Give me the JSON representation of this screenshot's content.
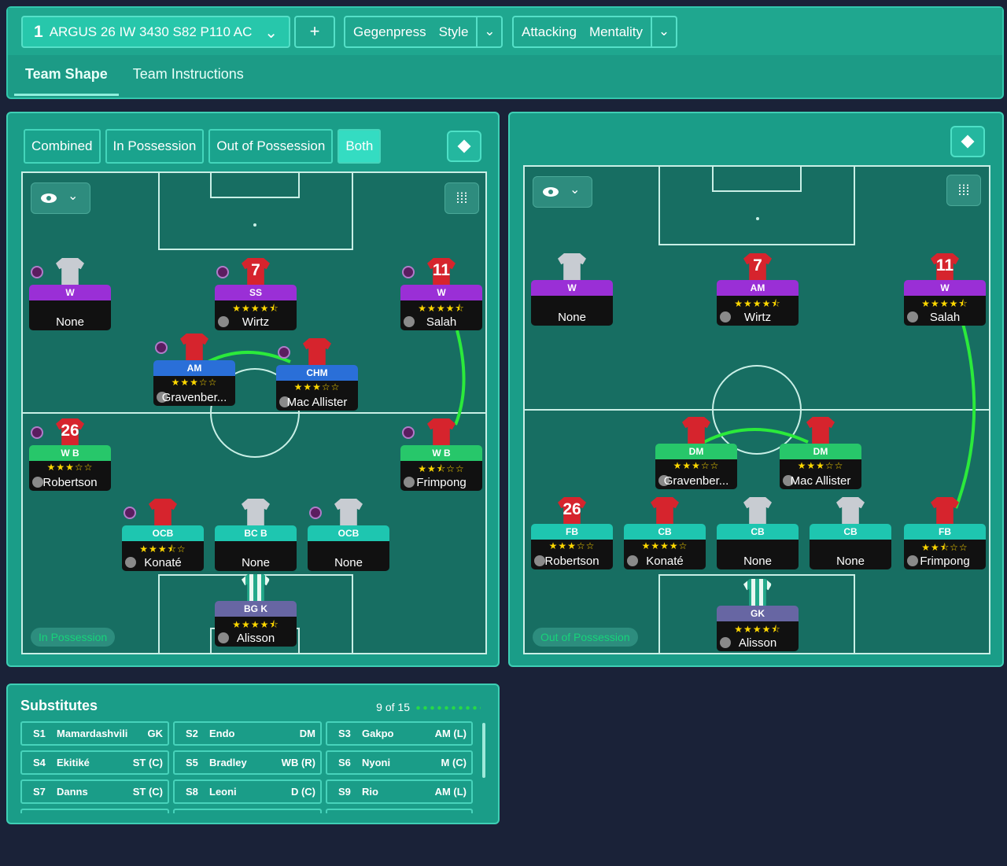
{
  "header": {
    "tactic_number": "1",
    "tactic_name": "ARGUS 26 IW 3430 S82 P110 AC",
    "add_label": "+",
    "style": {
      "label": "Gegenpress",
      "value": "Style"
    },
    "mentality": {
      "label": "Attacking",
      "value": "Mentality"
    },
    "tabs": [
      "Team Shape",
      "Team Instructions"
    ]
  },
  "left_panel": {
    "filters": [
      "Combined",
      "In Possession",
      "Out of Possession",
      "Both"
    ],
    "active_filter": "Both",
    "phase": "In Possession",
    "players": [
      {
        "id": "lw",
        "number": "",
        "shirt": "grey",
        "role": "W",
        "stars": "",
        "name": "None",
        "role_color": "purple",
        "badge": true
      },
      {
        "id": "ss",
        "number": "7",
        "shirt": "red",
        "role": "SS",
        "stars": "★★★★⯪",
        "name": "Wirtz",
        "role_color": "purple",
        "badge": true
      },
      {
        "id": "rw",
        "number": "11",
        "shirt": "red",
        "role": "W",
        "stars": "★★★★⯪",
        "name": "Salah",
        "role_color": "purple",
        "badge": true
      },
      {
        "id": "am",
        "number": "",
        "shirt": "red",
        "role": "AM",
        "stars": "★★★☆☆",
        "name": "Gravenber...",
        "role_color": "blue",
        "badge": true
      },
      {
        "id": "chm",
        "number": "",
        "shirt": "red",
        "role": "CHM",
        "stars": "★★★☆☆",
        "name": "Mac Allister",
        "role_color": "blue",
        "badge": true
      },
      {
        "id": "lwb",
        "number": "26",
        "shirt": "red",
        "role": "W B",
        "stars": "★★★☆☆",
        "name": "Robertson",
        "role_color": "green",
        "badge": true
      },
      {
        "id": "rwb",
        "number": "",
        "shirt": "red",
        "role": "W B",
        "stars": "★★⯪☆☆",
        "name": "Frimpong",
        "role_color": "green",
        "badge": true
      },
      {
        "id": "ocb1",
        "number": "",
        "shirt": "red",
        "role": "OCB",
        "stars": "★★★⯪☆",
        "name": "Konaté",
        "role_color": "teal",
        "badge": true
      },
      {
        "id": "bcb",
        "number": "",
        "shirt": "grey",
        "role": "BC B",
        "stars": "",
        "name": "None",
        "role_color": "teal",
        "badge": false
      },
      {
        "id": "ocb2",
        "number": "",
        "shirt": "grey",
        "role": "OCB",
        "stars": "",
        "name": "None",
        "role_color": "teal",
        "badge": true
      },
      {
        "id": "gk",
        "number": "",
        "shirt": "stripe",
        "role": "BG K",
        "stars": "★★★★⯪",
        "name": "Alisson",
        "role_color": "slate",
        "badge": false
      }
    ]
  },
  "right_panel": {
    "phase": "Out of Possession",
    "players": [
      {
        "id": "lw",
        "number": "",
        "shirt": "grey",
        "role": "W",
        "stars": "",
        "name": "None",
        "role_color": "purple"
      },
      {
        "id": "am",
        "number": "7",
        "shirt": "red",
        "role": "AM",
        "stars": "★★★★⯪",
        "name": "Wirtz",
        "role_color": "purple"
      },
      {
        "id": "rw",
        "number": "11",
        "shirt": "red",
        "role": "W",
        "stars": "★★★★⯪",
        "name": "Salah",
        "role_color": "purple"
      },
      {
        "id": "dm1",
        "number": "",
        "shirt": "red",
        "role": "DM",
        "stars": "★★★☆☆",
        "name": "Gravenber...",
        "role_color": "green"
      },
      {
        "id": "dm2",
        "number": "",
        "shirt": "red",
        "role": "DM",
        "stars": "★★★☆☆",
        "name": "Mac Allister",
        "role_color": "green"
      },
      {
        "id": "lfb",
        "number": "26",
        "shirt": "red",
        "role": "FB",
        "stars": "★★★☆☆",
        "name": "Robertson",
        "role_color": "teal"
      },
      {
        "id": "cb1",
        "number": "",
        "shirt": "red",
        "role": "CB",
        "stars": "★★★★☆",
        "name": "Konaté",
        "role_color": "teal"
      },
      {
        "id": "cb2",
        "number": "",
        "shirt": "grey",
        "role": "CB",
        "stars": "",
        "name": "None",
        "role_color": "teal"
      },
      {
        "id": "cb3",
        "number": "",
        "shirt": "grey",
        "role": "CB",
        "stars": "",
        "name": "None",
        "role_color": "teal"
      },
      {
        "id": "rfb",
        "number": "",
        "shirt": "red",
        "role": "FB",
        "stars": "★★⯪☆☆",
        "name": "Frimpong",
        "role_color": "teal"
      },
      {
        "id": "gk",
        "number": "",
        "shirt": "stripe",
        "role": "GK",
        "stars": "★★★★⯪",
        "name": "Alisson",
        "role_color": "slate"
      }
    ]
  },
  "substitutes": {
    "title": "Substitutes",
    "count": "9 of 15",
    "list": [
      {
        "slot": "S1",
        "name": "Mamardashvili",
        "pos": "GK"
      },
      {
        "slot": "S2",
        "name": "Endo",
        "pos": "DM"
      },
      {
        "slot": "S3",
        "name": "Gakpo",
        "pos": "AM (L)"
      },
      {
        "slot": "S4",
        "name": "Ekitiké",
        "pos": "ST (C)"
      },
      {
        "slot": "S5",
        "name": "Bradley",
        "pos": "WB (R)"
      },
      {
        "slot": "S6",
        "name": "Nyoni",
        "pos": "M (C)"
      },
      {
        "slot": "S7",
        "name": "Danns",
        "pos": "ST (C)"
      },
      {
        "slot": "S8",
        "name": "Leoni",
        "pos": "D (C)"
      },
      {
        "slot": "S9",
        "name": "Rio",
        "pos": "AM (L)"
      }
    ]
  },
  "colors": {
    "purple": "#9a2fd6",
    "blue": "#2a6fd8",
    "green": "#27c76a",
    "teal": "#1ec6b0",
    "slate": "#6766a3",
    "link": "#2bea3b"
  }
}
